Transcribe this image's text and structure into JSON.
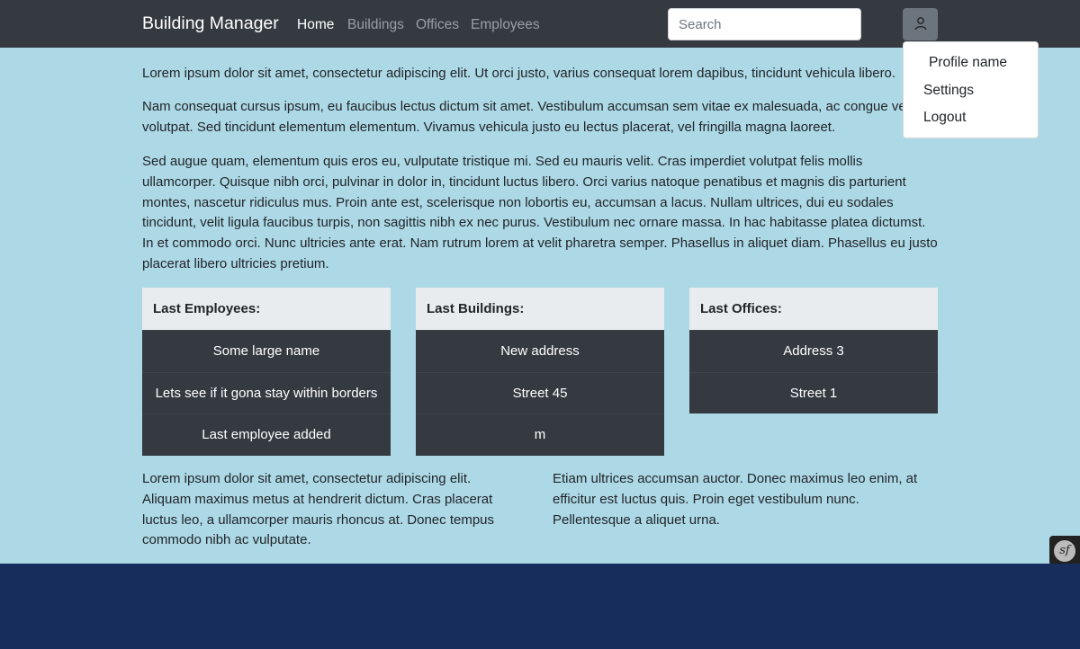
{
  "navbar": {
    "brand": "Building Manager",
    "links": [
      {
        "label": "Home",
        "active": true
      },
      {
        "label": "Buildings",
        "active": false
      },
      {
        "label": "Offices",
        "active": false
      },
      {
        "label": "Employees",
        "active": false
      }
    ],
    "search": {
      "placeholder": "Search",
      "value": ""
    },
    "profile_icon": "user-icon"
  },
  "profile_menu": {
    "header": "Profile name",
    "items": [
      {
        "label": "Settings"
      },
      {
        "label": "Logout"
      }
    ]
  },
  "content": {
    "paragraphs": [
      "Lorem ipsum dolor sit amet, consectetur adipiscing elit. Ut orci justo, varius consequat lorem dapibus, tincidunt vehicula libero.",
      "Nam consequat cursus ipsum, eu faucibus lectus dictum sit amet. Vestibulum accumsan sem vitae ex malesuada, ac congue velit volutpat. Sed tincidunt elementum elementum. Vivamus vehicula justo eu lectus placerat, vel fringilla magna laoreet.",
      "Sed augue quam, elementum quis eros eu, vulputate tristique mi. Sed eu mauris velit. Cras imperdiet volutpat felis mollis ullamcorper. Quisque nibh orci, pulvinar in dolor in, tincidunt luctus libero. Orci varius natoque penatibus et magnis dis parturient montes, nascetur ridiculus mus. Proin ante est, scelerisque non lobortis eu, accumsan a lacus. Nullam ultrices, dui eu sodales tincidunt, velit ligula faucibus turpis, non sagittis nibh ex nec purus. Vestibulum nec ornare massa. In hac habitasse platea dictumst. In et commodo orci. Nunc ultricies ante erat. Nam rutrum lorem at velit pharetra semper. Phasellus in aliquet diam. Phasellus eu justo placerat libero ultricies pretium."
    ],
    "cards": [
      {
        "title": "Last Employees:",
        "rows": [
          "Some large name",
          "Lets see if it gona stay within borders",
          "Last employee added"
        ]
      },
      {
        "title": "Last Buildings:",
        "rows": [
          "New address",
          "Street 45",
          "m"
        ]
      },
      {
        "title": "Last Offices:",
        "rows": [
          "Address 3",
          "Street 1"
        ]
      }
    ],
    "bottom_columns": [
      "Lorem ipsum dolor sit amet, consectetur adipiscing elit. Aliquam maximus metus at hendrerit dictum. Cras placerat luctus leo, a ullamcorper mauris rhoncus at. Donec tempus commodo nibh ac vulputate.",
      "Etiam ultrices accumsan auctor. Donec maximus leo enim, at efficitur est luctus quis. Proin eget vestibulum nunc. Pellentesque a aliquet urna."
    ]
  },
  "debug_toolbar": {
    "label": "sf",
    "icon": "symfony-icon"
  },
  "colors": {
    "navbar": "#343a40",
    "main_background": "#add8e6",
    "card_header": "#e9ecef",
    "card_body": "#343a40",
    "footer": "#172d5b"
  }
}
